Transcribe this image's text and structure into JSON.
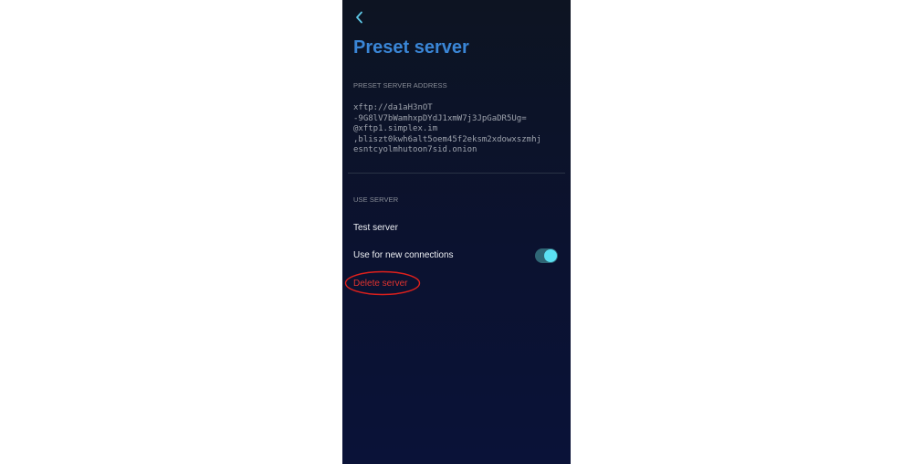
{
  "header": {
    "back_icon": "chevron-left-icon",
    "title": "Preset server"
  },
  "address_section": {
    "label": "PRESET SERVER ADDRESS",
    "lines": [
      "xftp://da1aH3nOT",
      "-9G8lV7bWamhxpDYdJ1xmW7j3JpGaDR5Ug=",
      "@xftp1.simplex.im",
      ",bliszt0kwh6alt5oem45f2eksm2xdowxszmhj",
      "esntcyolmhutoon7sid.onion"
    ]
  },
  "use_server_section": {
    "label": "USE SERVER",
    "test_server": "Test server",
    "use_for_new_connections": "Use for new connections",
    "use_for_new_connections_enabled": true,
    "delete_server": "Delete server"
  },
  "colors": {
    "title": "#3a86d6",
    "delete": "#e0332f",
    "toggle_track": "#2f6675",
    "toggle_knob": "#5be0f2",
    "annotation_ellipse": "#e0201c"
  }
}
